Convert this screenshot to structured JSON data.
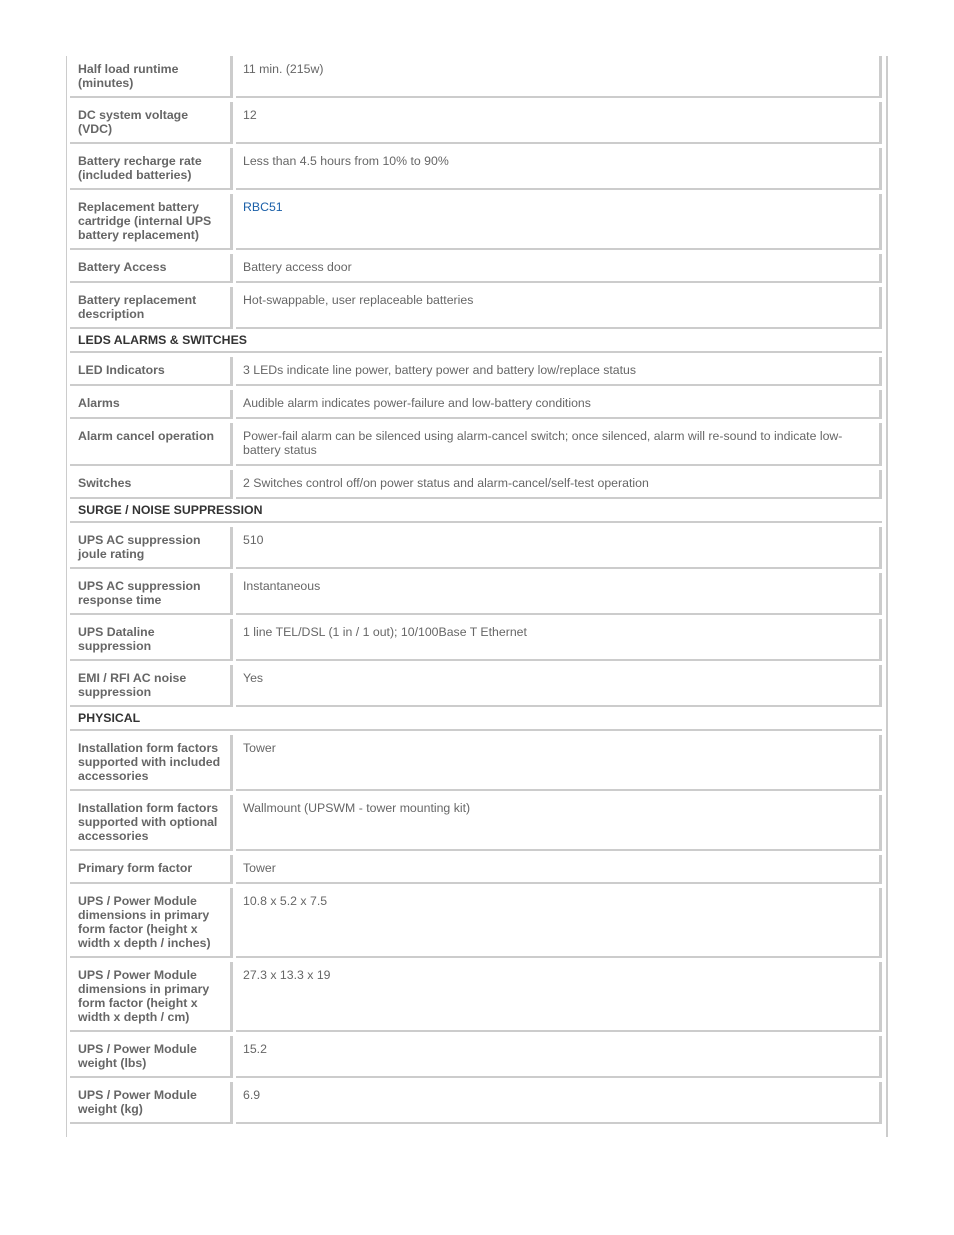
{
  "colors": {
    "link": "#1a5fa8",
    "text": "#666666",
    "heading": "#333333",
    "border": "#cccccc"
  },
  "rows": [
    {
      "type": "row",
      "label": "Half load runtime (minutes)",
      "value": "11 min. (215w)",
      "lines": 2
    },
    {
      "type": "row",
      "label": "DC system voltage (VDC)",
      "value": "12",
      "lines": 2
    },
    {
      "type": "row",
      "label": "Battery recharge rate (included batteries)",
      "value": "Less than 4.5 hours from 10% to 90%",
      "lines": 2
    },
    {
      "type": "row",
      "label": "Replacement battery cartridge (internal UPS battery replacement)",
      "value": "RBC51",
      "link": true,
      "lines": 3
    },
    {
      "type": "row",
      "label": "Battery Access",
      "value": "Battery access door",
      "lines": 1
    },
    {
      "type": "row",
      "label": "Battery replacement description",
      "value": "Hot-swappable, user replaceable batteries",
      "lines": 2
    },
    {
      "type": "section",
      "label": "LEDS ALARMS & SWITCHES"
    },
    {
      "type": "row",
      "label": "LED Indicators",
      "value": "3 LEDs indicate line power, battery power and battery low/replace status",
      "lines": 1
    },
    {
      "type": "row",
      "label": "Alarms",
      "value": "Audible alarm indicates power-failure and low-battery conditions",
      "lines": 1
    },
    {
      "type": "row",
      "label": "Alarm cancel operation",
      "value": "Power-fail alarm can be silenced using alarm-cancel switch; once silenced, alarm will re-sound to indicate low-battery status",
      "lines": 2
    },
    {
      "type": "row",
      "label": "Switches",
      "value": "2 Switches control off/on power status and alarm-cancel/self-test operation",
      "lines": 1
    },
    {
      "type": "section",
      "label": "SURGE / NOISE SUPPRESSION"
    },
    {
      "type": "row",
      "label": "UPS AC suppression joule rating",
      "value": "510",
      "lines": 2
    },
    {
      "type": "row",
      "label": "UPS AC suppression response time",
      "value": "Instantaneous",
      "lines": 2
    },
    {
      "type": "row",
      "label": "UPS Dataline suppression",
      "value": "1 line TEL/DSL (1 in / 1 out); 10/100Base T Ethernet",
      "lines": 2
    },
    {
      "type": "row",
      "label": "EMI / RFI AC noise suppression",
      "value": "Yes",
      "lines": 2
    },
    {
      "type": "section",
      "label": "PHYSICAL"
    },
    {
      "type": "row",
      "label": "Installation form factors supported with included accessories",
      "value": "Tower",
      "lines": 3
    },
    {
      "type": "row",
      "label": "Installation form factors supported with optional accessories",
      "value": "Wallmount (UPSWM - tower mounting kit)",
      "lines": 3
    },
    {
      "type": "row",
      "label": "Primary form factor",
      "value": "Tower",
      "lines": 1
    },
    {
      "type": "row",
      "label": "UPS / Power Module dimensions in primary form factor (height x width x depth / inches)",
      "value": "10.8 x 5.2 x 7.5",
      "lines": 4
    },
    {
      "type": "row",
      "label": "UPS / Power Module dimensions in primary form factor (height x width x depth / cm)",
      "value": "27.3 x 13.3 x 19",
      "lines": 4
    },
    {
      "type": "row",
      "label": "UPS / Power Module weight (lbs)",
      "value": "15.2",
      "lines": 2
    },
    {
      "type": "row",
      "label": "UPS / Power Module weight (kg)",
      "value": "6.9",
      "lines": 2
    }
  ]
}
